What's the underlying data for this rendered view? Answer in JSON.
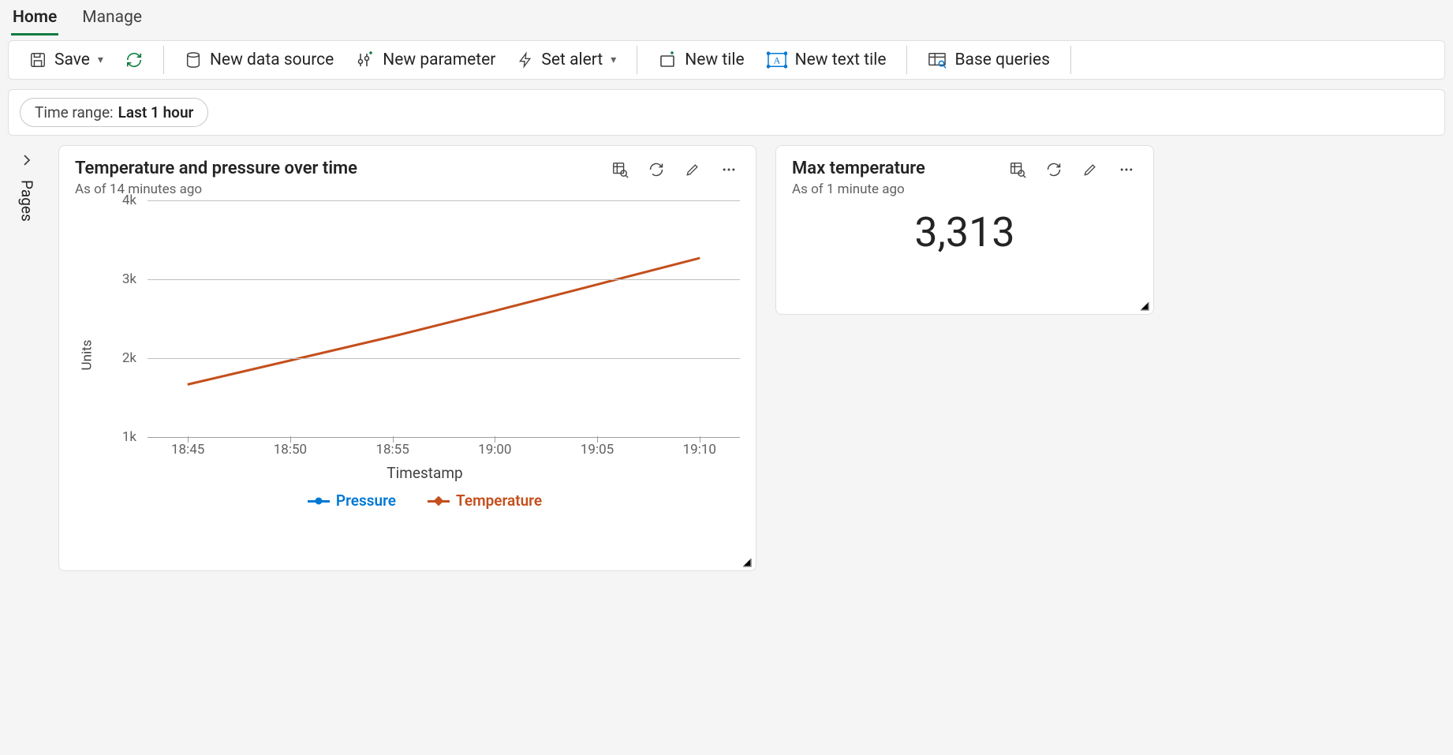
{
  "tabs": {
    "home": "Home",
    "manage": "Manage"
  },
  "toolbar": {
    "save": "Save",
    "new_data_source": "New data source",
    "new_parameter": "New parameter",
    "set_alert": "Set alert",
    "new_tile": "New tile",
    "new_text_tile": "New text tile",
    "base_queries": "Base queries"
  },
  "time_range": {
    "label": "Time range:",
    "value": "Last 1 hour"
  },
  "pages_label": "Pages",
  "tiles": {
    "chart": {
      "title": "Temperature and pressure over time",
      "subtitle": "As of 14 minutes ago"
    },
    "stat": {
      "title": "Max temperature",
      "subtitle": "As of 1 minute ago",
      "value": "3,313"
    }
  },
  "chart_data": {
    "type": "line",
    "title": "Temperature and pressure over time",
    "xlabel": "Timestamp",
    "ylabel": "Units",
    "ylim": [
      1000,
      4000
    ],
    "yticks": [
      "4k",
      "3k",
      "2k",
      "1k"
    ],
    "categories": [
      "18:45",
      "18:50",
      "18:55",
      "19:00",
      "19:05",
      "19:10"
    ],
    "series": [
      {
        "name": "Pressure",
        "color": "#0078d4",
        "values": [
          null,
          null,
          null,
          null,
          null,
          null
        ]
      },
      {
        "name": "Temperature",
        "color": "#c44f1c",
        "values": [
          1700,
          2000,
          2300,
          2620,
          2950,
          3280
        ]
      }
    ],
    "legend_position": "bottom",
    "grid": true
  }
}
